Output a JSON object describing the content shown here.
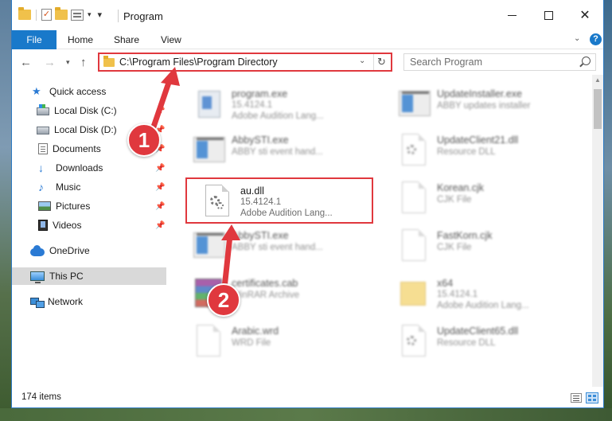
{
  "window": {
    "title": "Program",
    "accent": "#1979ca",
    "annotation_color": "#e0383e"
  },
  "ribbon": {
    "tabs": [
      "File",
      "Home",
      "Share",
      "View"
    ],
    "help": "?"
  },
  "address": {
    "path": "C:\\Program Files\\Program Directory",
    "search_placeholder": "Search Program"
  },
  "nav": {
    "items": [
      {
        "label": "Quick access",
        "icon": "star-icon",
        "pinned": false
      },
      {
        "label": "Local Disk (C:)",
        "icon": "disk-icon",
        "pinned": true
      },
      {
        "label": "Local Disk (D:)",
        "icon": "disk-icon",
        "pinned": true
      },
      {
        "label": "Documents",
        "icon": "document-icon",
        "pinned": true
      },
      {
        "label": "Downloads",
        "icon": "download-icon",
        "pinned": true
      },
      {
        "label": "Music",
        "icon": "music-icon",
        "pinned": true
      },
      {
        "label": "Pictures",
        "icon": "picture-icon",
        "pinned": true
      },
      {
        "label": "Videos",
        "icon": "video-icon",
        "pinned": true
      },
      {
        "label": "OneDrive",
        "icon": "cloud-icon",
        "pinned": false
      },
      {
        "label": "This PC",
        "icon": "computer-icon",
        "pinned": false,
        "selected": true
      },
      {
        "label": "Network",
        "icon": "network-icon",
        "pinned": false
      }
    ]
  },
  "files": [
    {
      "name": "program.exe",
      "line2": "15.4124.1",
      "line3": "Adobe Audition Lang...",
      "icon": "exe-icon"
    },
    {
      "name": "UpdateInstaller.exe",
      "line2": "ABBY updates installer",
      "line3": "",
      "icon": "app-icon"
    },
    {
      "name": "AbbySTI.exe",
      "line2": "ABBY sti event hand...",
      "line3": "",
      "icon": "app-icon"
    },
    {
      "name": "UpdateClient21.dll",
      "line2": "Resource DLL",
      "line3": "",
      "icon": "dll-icon"
    },
    {
      "name": "au.dll",
      "line2": "15.4124.1",
      "line3": "Adobe Audition Lang...",
      "icon": "dll-icon",
      "highlighted": true
    },
    {
      "name": "Korean.cjk",
      "line2": "CJK File",
      "line3": "",
      "icon": "file-icon"
    },
    {
      "name": "AbbySTI.exe",
      "line2": "ABBY sti event hand...",
      "line3": "",
      "icon": "app-icon"
    },
    {
      "name": "FastKorn.cjk",
      "line2": "CJK File",
      "line3": "",
      "icon": "file-icon"
    },
    {
      "name": "certificates.cab",
      "line2": "WinRAR Archive",
      "line3": "",
      "icon": "archive-icon"
    },
    {
      "name": "x64",
      "line2": "15.4124.1",
      "line3": "Adobe Audition Lang...",
      "icon": "folder-icon"
    },
    {
      "name": "Arabic.wrd",
      "line2": "WRD File",
      "line3": "",
      "icon": "file-icon"
    },
    {
      "name": "UpdateClient65.dll",
      "line2": "Resource DLL",
      "line3": "",
      "icon": "dll-icon"
    }
  ],
  "callouts": [
    "1",
    "2"
  ],
  "status": {
    "item_count": "174 items"
  }
}
